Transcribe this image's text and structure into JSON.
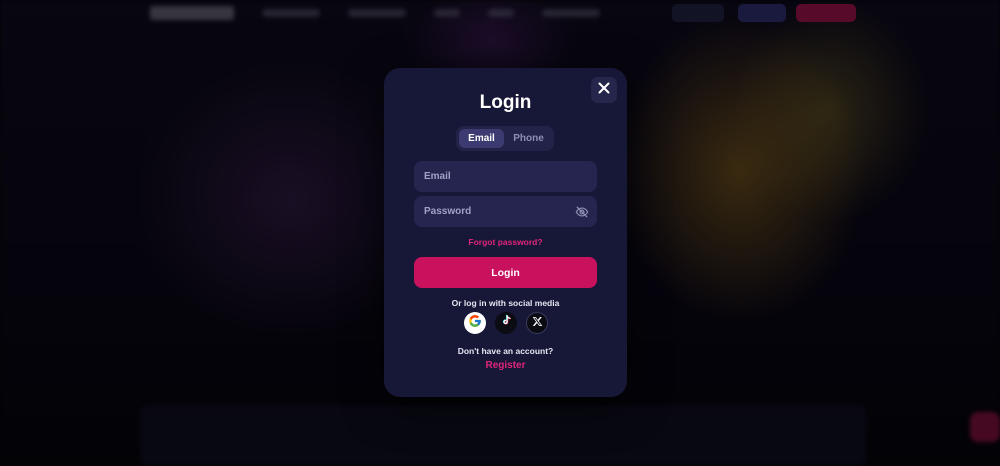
{
  "modal": {
    "title": "Login",
    "tabs": [
      {
        "label": "Email",
        "active": true
      },
      {
        "label": "Phone",
        "active": false
      }
    ],
    "email_field": {
      "value": "",
      "placeholder": "Email"
    },
    "password_field": {
      "value": "",
      "placeholder": "Password"
    },
    "forgot_password": "Forgot password?",
    "login_button": "Login",
    "social_label": "Or log in with social media",
    "socials": [
      "google-icon",
      "tiktok-icon",
      "x-icon"
    ],
    "no_account": "Don't have an account?",
    "register": "Register"
  },
  "colors": {
    "accent": "#c8125e",
    "link": "#e0257a",
    "modal_bg": "#171737",
    "field_bg": "#25254f"
  }
}
